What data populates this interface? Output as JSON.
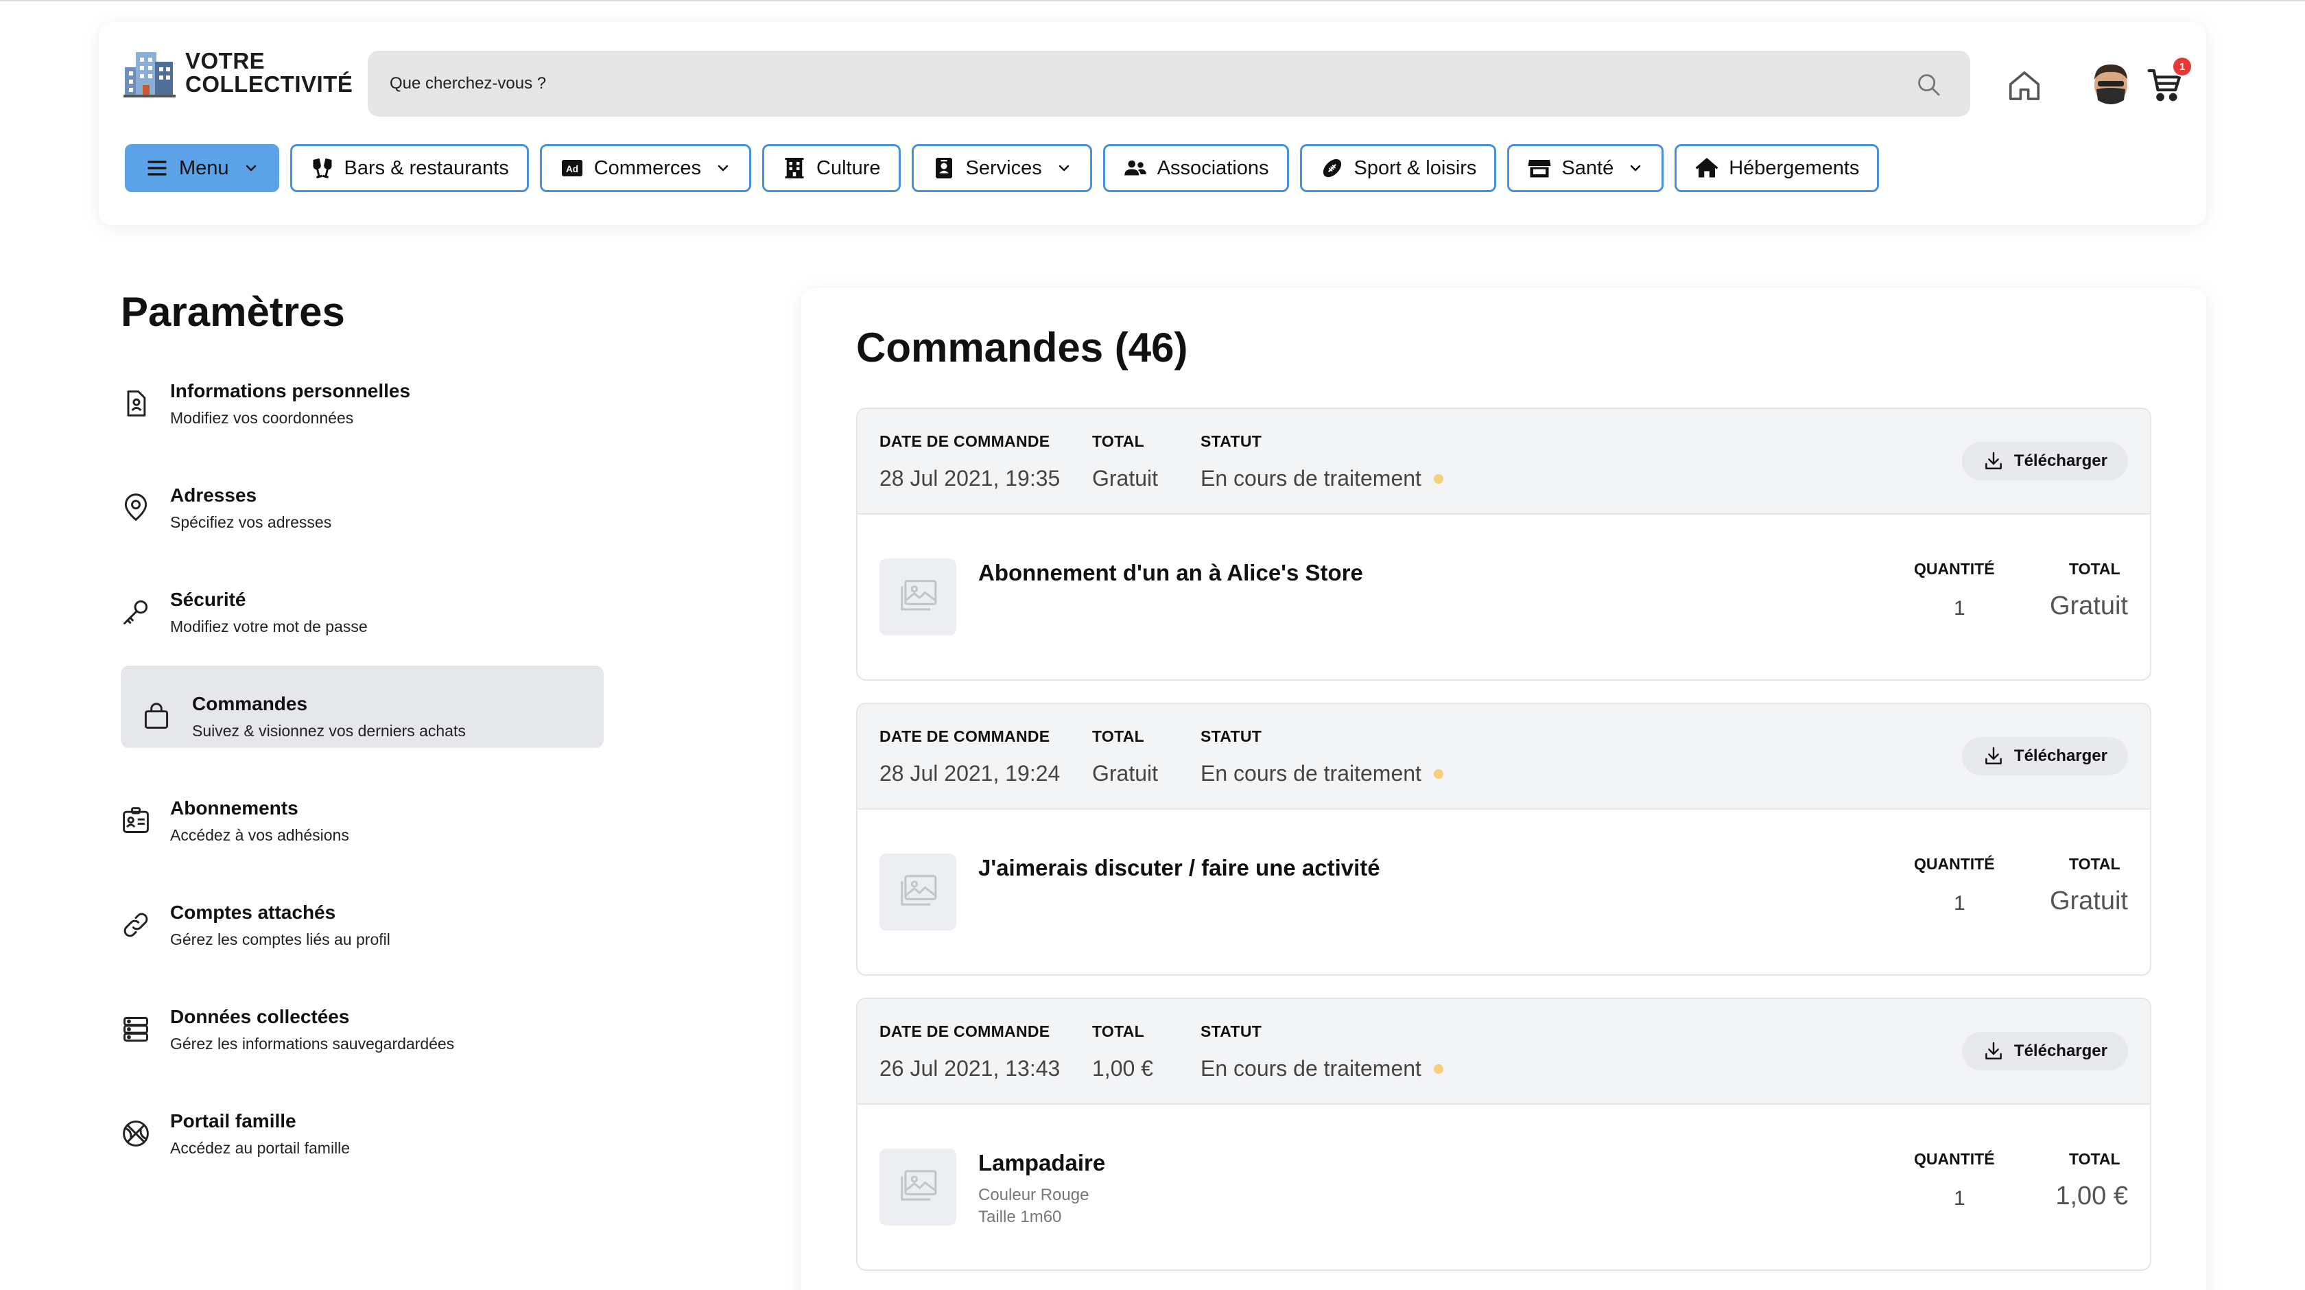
{
  "header": {
    "logo": {
      "line1": "VOTRE",
      "line2": "COLLECTIVITÉ"
    },
    "search": {
      "placeholder": "Que cherchez-vous ?"
    },
    "cart_count": "1"
  },
  "nav": [
    {
      "label": "Menu",
      "icon": "hamburger-icon",
      "dropdown": true
    },
    {
      "label": "Bars & restaurants",
      "icon": "cheers-icon",
      "dropdown": false
    },
    {
      "label": "Commerces",
      "icon": "ad-icon",
      "dropdown": true
    },
    {
      "label": "Culture",
      "icon": "building-icon",
      "dropdown": false
    },
    {
      "label": "Services",
      "icon": "id-badge-icon",
      "dropdown": true
    },
    {
      "label": "Associations",
      "icon": "users-icon",
      "dropdown": false
    },
    {
      "label": "Sport & loisirs",
      "icon": "football-icon",
      "dropdown": false
    },
    {
      "label": "Santé",
      "icon": "store-icon",
      "dropdown": true
    },
    {
      "label": "Hébergements",
      "icon": "house-icon",
      "dropdown": false
    }
  ],
  "sidebar": {
    "title": "Paramètres",
    "items": [
      {
        "title": "Informations personnelles",
        "subtitle": "Modifiez vos coordonnées",
        "icon": "document-icon"
      },
      {
        "title": "Adresses",
        "subtitle": "Spécifiez vos adresses",
        "icon": "location-pin-icon"
      },
      {
        "title": "Sécurité",
        "subtitle": "Modifiez votre mot de passe",
        "icon": "key-icon"
      },
      {
        "title": "Commandes",
        "subtitle": "Suivez & visionnez vos derniers achats",
        "icon": "shopping-bag-icon",
        "active": true
      },
      {
        "title": "Abonnements",
        "subtitle": "Accédez à vos adhésions",
        "icon": "membership-card-icon"
      },
      {
        "title": "Comptes attachés",
        "subtitle": "Gérez les comptes liés au profil",
        "icon": "link-icon"
      },
      {
        "title": "Données collectées",
        "subtitle": "Gérez les informations sauvegardardées",
        "icon": "database-icon"
      },
      {
        "title": "Portail famille",
        "subtitle": "Accédez au portail famille",
        "icon": "basketball-icon"
      }
    ]
  },
  "orders": {
    "title": "Commandes (46)",
    "labels": {
      "date": "DATE DE COMMANDE",
      "total": "TOTAL",
      "status": "STATUT",
      "quantity": "QUANTITÉ",
      "download": "Télécharger"
    },
    "status_color": "#f5cf7a",
    "list": [
      {
        "date": "28 Jul 2021, 19:35",
        "total": "Gratuit",
        "status": "En cours de traitement",
        "product": "Abonnement d'un an à Alice's Store",
        "attributes": [],
        "quantity": "1",
        "item_total": "Gratuit"
      },
      {
        "date": "28 Jul 2021, 19:24",
        "total": "Gratuit",
        "status": "En cours de traitement",
        "product": "J'aimerais discuter / faire une activité",
        "attributes": [],
        "quantity": "1",
        "item_total": "Gratuit"
      },
      {
        "date": "26 Jul 2021, 13:43",
        "total": "1,00 €",
        "status": "En cours de traitement",
        "product": "Lampadaire",
        "attributes": [
          "Couleur Rouge",
          "Taille 1m60"
        ],
        "quantity": "1",
        "item_total": "1,00 €"
      }
    ]
  },
  "colors": {
    "nav_border": "#4a90d9",
    "nav_primary_bg": "#5ba2e6",
    "badge": "#e53935"
  }
}
